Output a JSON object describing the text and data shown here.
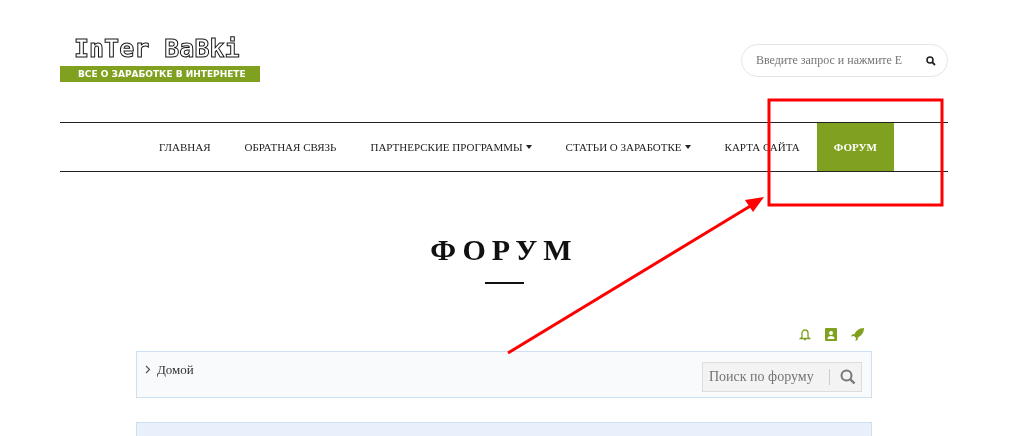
{
  "logo": {
    "title": "InTer BaBki",
    "tagline": "ВСЕ О ЗАРАБОТКЕ В ИНТЕРНЕТЕ"
  },
  "search": {
    "placeholder": "Введите запрос и нажмите E"
  },
  "nav": [
    {
      "label": "ГЛАВНАЯ",
      "dropdown": false,
      "selected": false
    },
    {
      "label": "ОБРАТНАЯ СВЯЗЬ",
      "dropdown": false,
      "selected": false
    },
    {
      "label": "ПАРТНЕРСКИЕ ПРОГРАММЫ",
      "dropdown": true,
      "selected": false
    },
    {
      "label": "СТАТЬИ О ЗАРАБОТКЕ",
      "dropdown": true,
      "selected": false
    },
    {
      "label": "КАРТА САЙТА",
      "dropdown": false,
      "selected": false
    },
    {
      "label": "ФОРУМ",
      "dropdown": false,
      "selected": true
    }
  ],
  "page_title": "ФОРУМ",
  "breadcrumb": [
    "Домой"
  ],
  "forum_search": {
    "placeholder": "Поиск по форуму"
  }
}
